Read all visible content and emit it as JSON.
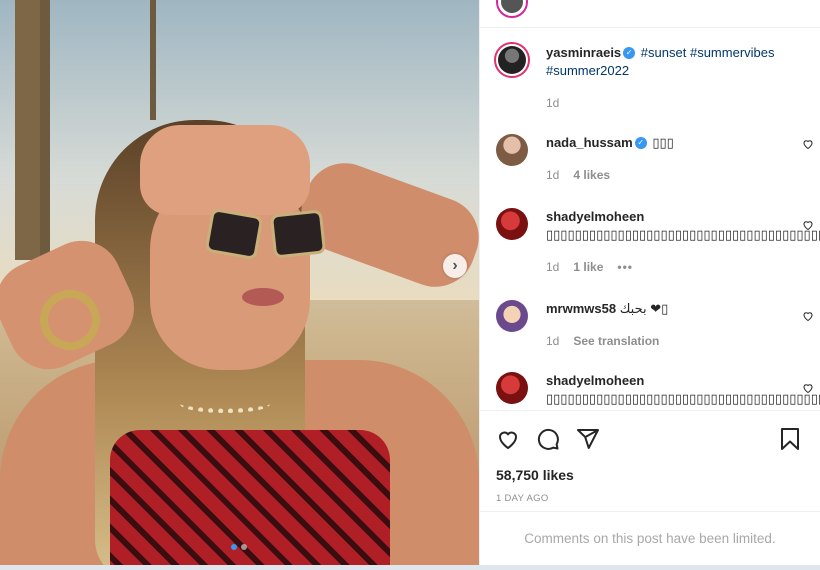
{
  "photo": {
    "alt": "",
    "carousel": {
      "total": 2,
      "active": 1
    },
    "next_symbol": "›"
  },
  "caption": {
    "username": "yasminraeis",
    "text_tags": [
      "#sunset",
      "#summervibes",
      "#summer2022"
    ],
    "time": "1d"
  },
  "comments": [
    {
      "username": "nada_hussam",
      "verified": true,
      "text": "▯▯▯",
      "time": "1d",
      "likes": "4 likes"
    },
    {
      "username": "shadyelmoheen",
      "verified": false,
      "text": "▯▯▯▯▯▯▯▯▯▯▯▯▯▯▯▯▯▯▯▯▯▯▯▯▯▯▯▯▯▯▯▯▯▯▯▯▯▯▯▯▯▯▯▯▯",
      "time": "1d",
      "likes": "1 like",
      "more": "•••"
    },
    {
      "username": "mrwmws58",
      "verified": false,
      "text": "بحبك ❤▯",
      "time": "1d",
      "translate": "See translation"
    },
    {
      "username": "shadyelmoheen",
      "verified": false,
      "text": "▯▯▯▯▯▯▯▯▯▯▯▯▯▯▯▯▯▯▯▯▯▯▯▯▯▯▯▯▯▯▯▯▯▯▯▯▯▯▯▯▯▯▯▯▯"
    }
  ],
  "actions": {
    "likes": "58,750 likes",
    "posted": "1 DAY AGO",
    "limited": "Comments on this post have been limited."
  },
  "colors": {
    "verified": "#3897f0",
    "hashtag": "#00376b",
    "muted": "#8e8e8e"
  },
  "icons": [
    "heart-icon",
    "comment-icon",
    "share-icon",
    "bookmark-icon",
    "chevron-right-icon",
    "verified-icon"
  ]
}
